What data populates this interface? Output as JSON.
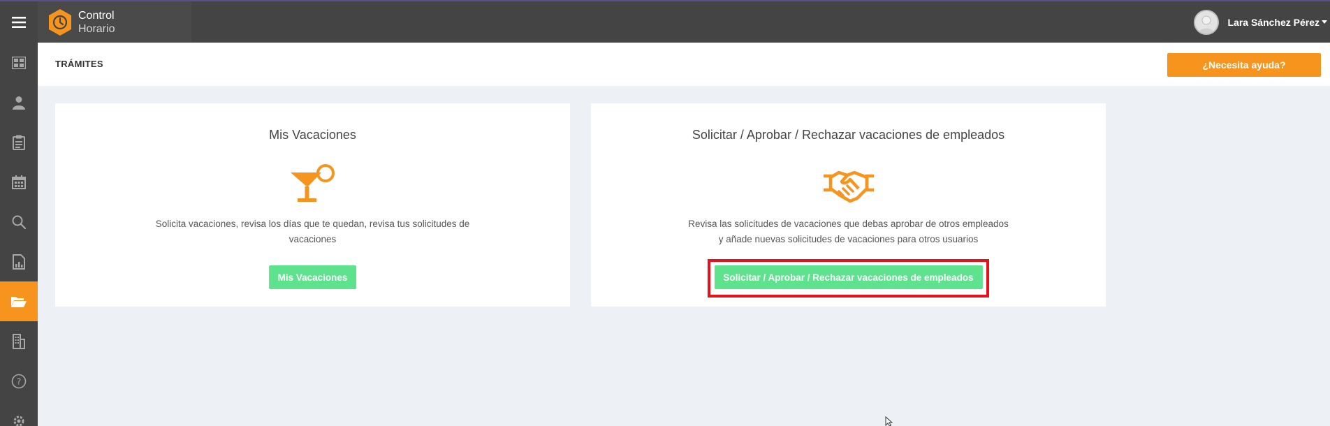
{
  "app": {
    "brand_line1": "Control",
    "brand_line2": "Horario",
    "user_name": "Lara Sánchez Pérez"
  },
  "colors": {
    "accent": "#f7941d",
    "topbar": "#444444",
    "button_green": "#5ee28e",
    "highlight_red": "#e8101a"
  },
  "sidebar": {
    "items": [
      {
        "icon": "dashboard-icon",
        "active": false
      },
      {
        "icon": "user-icon",
        "active": false
      },
      {
        "icon": "clipboard-icon",
        "active": false
      },
      {
        "icon": "calendar-icon",
        "active": false
      },
      {
        "icon": "search-icon",
        "active": false
      },
      {
        "icon": "report-icon",
        "active": false
      },
      {
        "icon": "folder-open-icon",
        "active": true
      },
      {
        "icon": "building-icon",
        "active": false
      },
      {
        "icon": "help-circle-icon",
        "active": false
      },
      {
        "icon": "gear-icon",
        "active": false
      }
    ]
  },
  "header": {
    "title": "TRÁMITES",
    "help_label": "¿Necesita ayuda?"
  },
  "cards": [
    {
      "title": "Mis Vacaciones",
      "icon": "cocktail-icon",
      "description": "Solicita vacaciones, revisa los días que te quedan, revisa tus solicitudes de vacaciones",
      "button": "Mis Vacaciones"
    },
    {
      "title": "Solicitar / Aprobar / Rechazar vacaciones de empleados",
      "icon": "handshake-icon",
      "description_line1": "Revisa las solicitudes de vacaciones que debas aprobar de otros empleados",
      "description_line2": "y añade nuevas solicitudes de vacaciones para otros usuarios",
      "button": "Solicitar / Aprobar / Rechazar vacaciones de empleados"
    }
  ]
}
